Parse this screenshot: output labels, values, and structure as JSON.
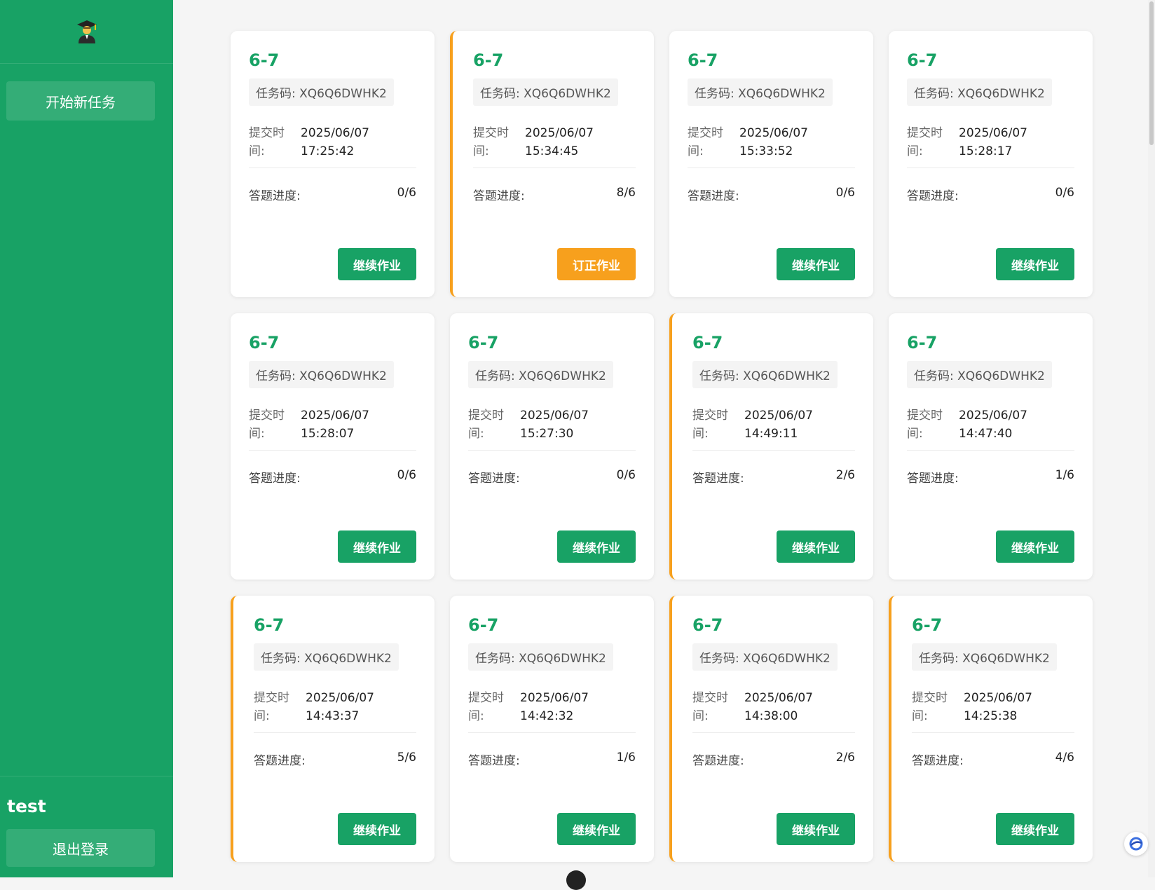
{
  "sidebar": {
    "avatar_icon": "student-graduate-icon",
    "new_task_label": "开始新任务",
    "username": "test",
    "logout_label": "退出登录"
  },
  "labels": {
    "submit_time_line1": "提交时",
    "submit_time_line2": "间:",
    "progress": "答题进度:"
  },
  "colors": {
    "brand_green": "#18a265",
    "accent_orange": "#f7a01d"
  },
  "cards": [
    {
      "title": "6-7",
      "code": "任务码: XQ6Q6DWHK2",
      "date": "2025/06/07",
      "time": "17:25:42",
      "progress": "0/6",
      "button": "继续作业",
      "correction": false
    },
    {
      "title": "6-7",
      "code": "任务码: XQ6Q6DWHK2",
      "date": "2025/06/07",
      "time": "15:34:45",
      "progress": "8/6",
      "button": "订正作业",
      "correction": true
    },
    {
      "title": "6-7",
      "code": "任务码: XQ6Q6DWHK2",
      "date": "2025/06/07",
      "time": "15:33:52",
      "progress": "0/6",
      "button": "继续作业",
      "correction": false
    },
    {
      "title": "6-7",
      "code": "任务码: XQ6Q6DWHK2",
      "date": "2025/06/07",
      "time": "15:28:17",
      "progress": "0/6",
      "button": "继续作业",
      "correction": false
    },
    {
      "title": "6-7",
      "code": "任务码: XQ6Q6DWHK2",
      "date": "2025/06/07",
      "time": "15:28:07",
      "progress": "0/6",
      "button": "继续作业",
      "correction": false
    },
    {
      "title": "6-7",
      "code": "任务码: XQ6Q6DWHK2",
      "date": "2025/06/07",
      "time": "15:27:30",
      "progress": "0/6",
      "button": "继续作业",
      "correction": false
    },
    {
      "title": "6-7",
      "code": "任务码: XQ6Q6DWHK2",
      "date": "2025/06/07",
      "time": "14:49:11",
      "progress": "2/6",
      "button": "继续作业",
      "correction": true
    },
    {
      "title": "6-7",
      "code": "任务码: XQ6Q6DWHK2",
      "date": "2025/06/07",
      "time": "14:47:40",
      "progress": "1/6",
      "button": "继续作业",
      "correction": false
    },
    {
      "title": "6-7",
      "code": "任务码: XQ6Q6DWHK2",
      "date": "2025/06/07",
      "time": "14:43:37",
      "progress": "5/6",
      "button": "继续作业",
      "correction": true
    },
    {
      "title": "6-7",
      "code": "任务码: XQ6Q6DWHK2",
      "date": "2025/06/07",
      "time": "14:42:32",
      "progress": "1/6",
      "button": "继续作业",
      "correction": false
    },
    {
      "title": "6-7",
      "code": "任务码: XQ6Q6DWHK2",
      "date": "2025/06/07",
      "time": "14:38:00",
      "progress": "2/6",
      "button": "继续作业",
      "correction": true
    },
    {
      "title": "6-7",
      "code": "任务码: XQ6Q6DWHK2",
      "date": "2025/06/07",
      "time": "14:25:38",
      "progress": "4/6",
      "button": "继续作业",
      "correction": true
    }
  ]
}
